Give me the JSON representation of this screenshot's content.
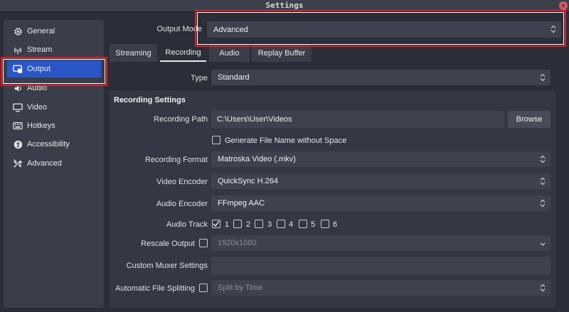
{
  "window": {
    "title": "Settings"
  },
  "sidebar": {
    "items": [
      {
        "label": "General",
        "icon": "gear-icon"
      },
      {
        "label": "Stream",
        "icon": "antenna-icon"
      },
      {
        "label": "Output",
        "icon": "output-icon",
        "active": true
      },
      {
        "label": "Audio",
        "icon": "speaker-icon"
      },
      {
        "label": "Video",
        "icon": "monitor-icon"
      },
      {
        "label": "Hotkeys",
        "icon": "keyboard-icon"
      },
      {
        "label": "Accessibility",
        "icon": "accessibility-icon"
      },
      {
        "label": "Advanced",
        "icon": "tools-icon"
      }
    ]
  },
  "output_mode": {
    "label": "Output Mode",
    "value": "Advanced"
  },
  "tabs": [
    {
      "label": "Streaming"
    },
    {
      "label": "Recording",
      "active": true
    },
    {
      "label": "Audio"
    },
    {
      "label": "Replay Buffer"
    }
  ],
  "type": {
    "label": "Type",
    "value": "Standard"
  },
  "recording": {
    "group_title": "Recording Settings",
    "path": {
      "label": "Recording Path",
      "value": "C:\\Users\\User\\Videos",
      "browse_label": "Browse"
    },
    "no_space": {
      "label": "Generate File Name without Space",
      "checked": false
    },
    "format": {
      "label": "Recording Format",
      "value": "Matroska Video (.mkv)"
    },
    "video_encoder": {
      "label": "Video Encoder",
      "value": "QuickSync H.264"
    },
    "audio_encoder": {
      "label": "Audio Encoder",
      "value": "FFmpeg AAC"
    },
    "audio_track": {
      "label": "Audio Track",
      "tracks": [
        {
          "label": "1",
          "checked": true
        },
        {
          "label": "2",
          "checked": false
        },
        {
          "label": "3",
          "checked": false
        },
        {
          "label": "4",
          "checked": false
        },
        {
          "label": "5",
          "checked": false
        },
        {
          "label": "6",
          "checked": false
        }
      ]
    },
    "rescale": {
      "label": "Rescale Output",
      "value": "1920x1080",
      "checked": false
    },
    "muxer": {
      "label": "Custom Muxer Settings",
      "value": ""
    },
    "splitting": {
      "label": "Automatic File Splitting",
      "value": "Split by Time",
      "checked": false
    }
  },
  "colors": {
    "accent": "#2a56c7",
    "highlight": "#d8202a",
    "background": "#2b2e38"
  }
}
